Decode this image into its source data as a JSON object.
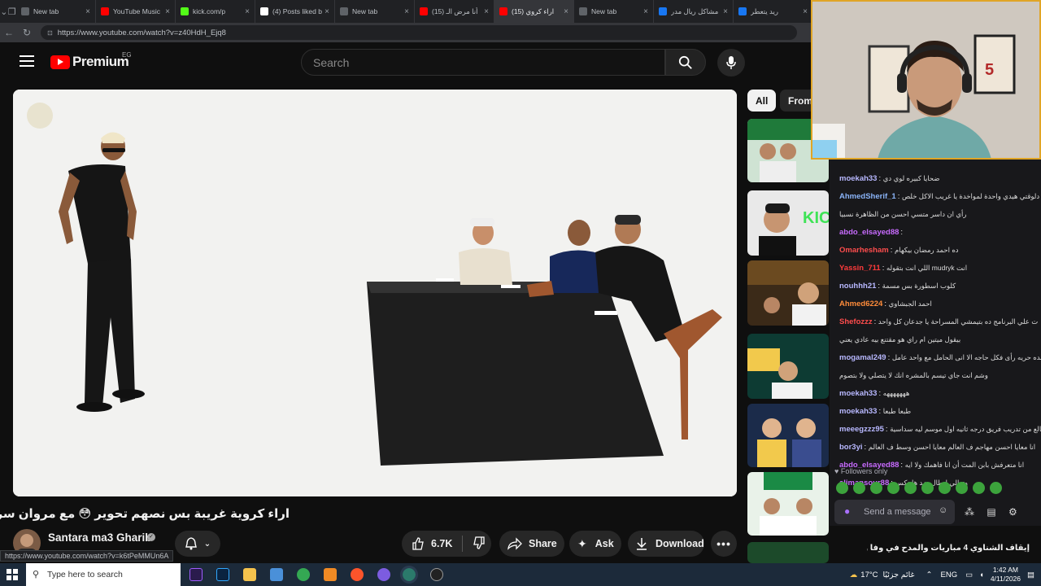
{
  "browser": {
    "tabs": [
      {
        "label": "New tab",
        "color": "#5f6368"
      },
      {
        "label": "YouTube Music",
        "color": "#ff0000"
      },
      {
        "label": "kick.com/p",
        "color": "#53fc18"
      },
      {
        "label": "(4) Posts liked by",
        "color": "#ffffff"
      },
      {
        "label": "New tab",
        "color": "#5f6368"
      },
      {
        "label": "(15) أنا مرض الـ",
        "color": "#ff0000"
      },
      {
        "label": "(15) اراء كروي",
        "color": "#ff0000"
      },
      {
        "label": "New tab",
        "color": "#5f6368"
      },
      {
        "label": "مشاكل ريال مدر",
        "color": "#1877f2"
      },
      {
        "label": "ريد يتعطر",
        "color": "#1877f2"
      }
    ],
    "url": "https://www.youtube.com/watch?v=z40HdH_Ejq8",
    "status_url": "https://www.youtube.com/watch?v=k6tPeMMUn6A"
  },
  "youtube": {
    "logo_text": "Premium",
    "country": "EG",
    "search_placeholder": "Search",
    "video_title": "اراء كروية غريبة بس نصهم تحوير 😳 مع مروان سري و جو",
    "channel_name": "Santara ma3 Gharib",
    "likes": "6.7K",
    "share_label": "Share",
    "ask_label": "Ask",
    "download_label": "Download",
    "chips": [
      "All",
      "From"
    ],
    "notification_title": "إيقاف الشناوي 4 مباريات والمدح في وفا و"
  },
  "chat": {
    "messages": [
      {
        "user": "moekah33",
        "color": "#b8b8ff",
        "text": "ضحايا كبيره لوي دي"
      },
      {
        "user": "AhmedSherif_1",
        "color": "#8ab4f8",
        "text": "وي دلوقتي هيدي واحدة لمواخدة يا غريب الاكل خلص"
      },
      {
        "user": "",
        "color": "#dcdcdc",
        "text": "رأي ان داسر متسي احسن من الظاهرة نسبيا"
      },
      {
        "user": "abdo_elsayed88",
        "color": "#c86bff",
        "text": ""
      },
      {
        "user": "Omarhesham",
        "color": "#ff4d4d",
        "text": "ده احمد رمضان بيكهام"
      },
      {
        "user": "Yassin_711",
        "color": "#ff3b3b",
        "text": "اللي انت بتقوله mudryk انت"
      },
      {
        "user": "nouhhh21",
        "color": "#b8b8ff",
        "text": "كلوب اسطورة بس مسمة"
      },
      {
        "user": "Ahmed6224",
        "color": "#ff8c3a",
        "text": "احمد الجبشاوي"
      },
      {
        "user": "Shefozzz",
        "color": "#ff4d4d",
        "text": "ت علي البرنامج ده بتيمشي المسراحة يا جدعان كل واحد"
      },
      {
        "user": "",
        "color": "#dcdcdc",
        "text": "بيقول ميتين ام راي هو مقتنع بيه عادي يعني"
      },
      {
        "user": "mogamal249",
        "color": "#b8b8ff",
        "text": "عنده حريه رأى فكل حاجه الا انى الحامل مع واحد عامل"
      },
      {
        "user": "",
        "color": "#dcdcdc",
        "text": "وشم انت جاي تيسم بالمشره انك لا يتصلي ولا بتصوم"
      },
      {
        "user": "moekah33",
        "color": "#b8b8ff",
        "text": "هههههههه"
      },
      {
        "user": "moekah33",
        "color": "#b8b8ff",
        "text": "طبعا طبعا"
      },
      {
        "user": "meeegzzz95",
        "color": "#b8b8ff",
        "text": "لا طالع من تدريب فريق درجه ثانيه اول موسم ليه سداسية"
      },
      {
        "user": "bor3yi",
        "color": "#b8b8ff",
        "text": "انا معايا احسن مهاجم ف العالم معايا احسن وسط ف العالم"
      },
      {
        "user": "abdo_elsayed88",
        "color": "#c86bff",
        "text": "انا متعرفش بابن المت أن انا فاهمك ولا ايه"
      },
      {
        "user": "alimansour88",
        "color": "#c86bff",
        "text": "وتهالي ابطال ضد هاينكس"
      }
    ],
    "followers_only": "Followers only",
    "input_placeholder": "Send a message"
  },
  "taskbar": {
    "search_placeholder": "Type here to search",
    "weather": "17°C",
    "weather_text": "غائم جزئيًا",
    "language": "ENG",
    "time": "1:42 AM",
    "date": "4/11/2026"
  }
}
